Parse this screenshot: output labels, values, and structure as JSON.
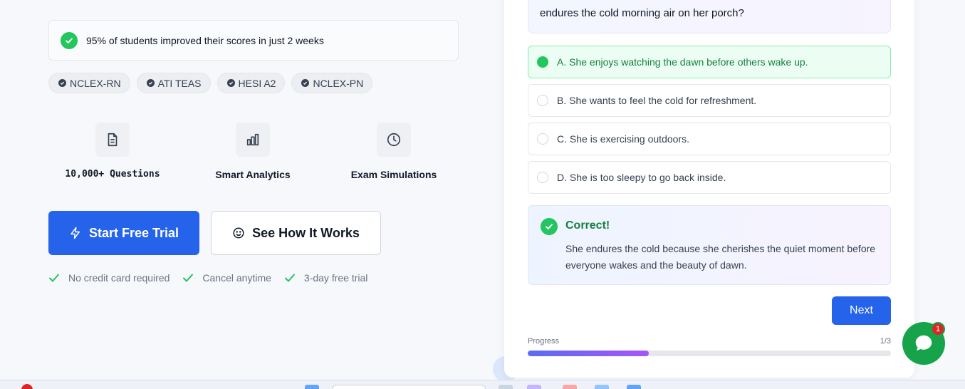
{
  "left": {
    "stat_text": "95% of students improved their scores in just 2 weeks",
    "tags": [
      "NCLEX-RN",
      "ATI TEAS",
      "HESI A2",
      "NCLEX-PN"
    ],
    "features": [
      {
        "label": "10,000+ Questions",
        "icon": "document-icon"
      },
      {
        "label": "Smart Analytics",
        "icon": "bar-chart-icon"
      },
      {
        "label": "Exam Simulations",
        "icon": "clock-icon"
      }
    ],
    "primary_button": "Start Free Trial",
    "secondary_button": "See How It Works",
    "perks": [
      "No credit card required",
      "Cancel anytime",
      "3-day free trial"
    ]
  },
  "quiz": {
    "question_tail": "endures the cold morning air on her porch?",
    "options": [
      {
        "label": "A. She enjoys watching the dawn before others wake up.",
        "selected": true
      },
      {
        "label": "B. She wants to feel the cold for refreshment.",
        "selected": false
      },
      {
        "label": "C. She is exercising outdoors.",
        "selected": false
      },
      {
        "label": "D. She is too sleepy to go back inside.",
        "selected": false
      }
    ],
    "result_title": "Correct!",
    "result_explanation": "She endures the cold because she cherishes the quiet moment before everyone wakes and the beauty of dawn.",
    "next_button": "Next",
    "progress_label": "Progress",
    "progress_count": "1/3",
    "progress_fraction": 0.333
  },
  "chat": {
    "badge": "1"
  },
  "colors": {
    "accent": "#2563eb",
    "success": "#22c55e",
    "chat": "#16a34a"
  }
}
